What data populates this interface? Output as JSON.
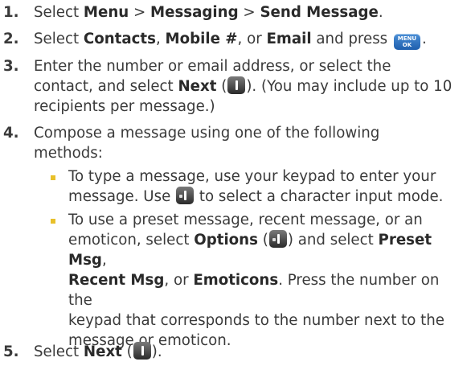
{
  "steps": [
    {
      "num": "1.",
      "pre": "Select ",
      "b1": "Menu",
      "s1": " > ",
      "b2": "Messaging",
      "s2": " > ",
      "b3": "Send Message",
      "post": "."
    },
    {
      "num": "2.",
      "pre": "Select ",
      "b1": "Contacts",
      "s1": ", ",
      "b2": "Mobile #",
      "s2": ", or ",
      "b3": "Email",
      "s3": " and press ",
      "post": "."
    },
    {
      "num": "3.",
      "line1": "Enter the number or email address, or select the",
      "line2_pre": "contact, and select ",
      "b1": "Next",
      "s1": " (",
      "s2": "). (You may include up to 10",
      "line3": "recipients per message.)"
    },
    {
      "num": "4.",
      "line1": "Compose a message using one of the following",
      "line2": "methods:"
    },
    {
      "num": "5.",
      "pre": "Select ",
      "b1": "Next",
      "s1": " (",
      "post": ")."
    }
  ],
  "bullets": [
    {
      "line1": "To type a message, use your keypad to enter your",
      "line2_pre": "message. Use ",
      "line2_post": " to select a character input mode."
    },
    {
      "line1_pre": "To use a preset message, recent message, or an",
      "line2_pre": "emoticon, select ",
      "b1": "Options",
      "s1": " (",
      "s2": ") and select ",
      "b2": "Preset Msg",
      "s3": ",",
      "b3": "Recent Msg",
      "s4": ", or ",
      "b4": "Emoticons",
      "s5": ". Press the number on the",
      "line4": "keypad that corresponds to the number next to the",
      "line5": "message or emoticon."
    }
  ],
  "icons": {
    "menu_ok": {
      "name": "menu-ok-key-icon",
      "line1": "MENU",
      "line2": "OK"
    },
    "right_softkey": "right-softkey-icon",
    "left_softkey": "left-softkey-icon"
  }
}
